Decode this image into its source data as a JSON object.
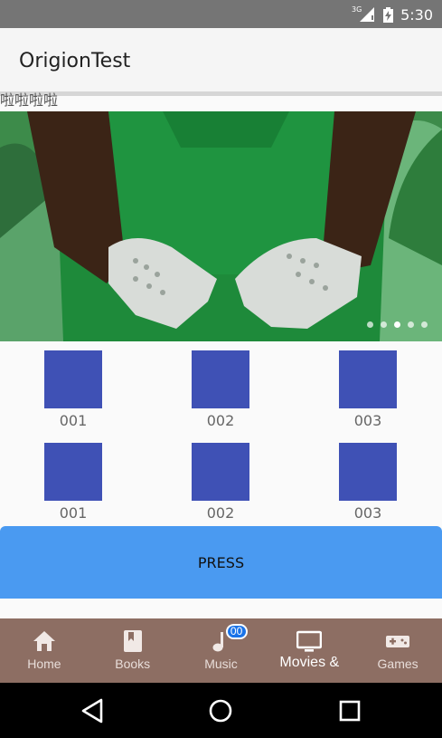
{
  "status_bar": {
    "time": "5:30",
    "network_label": "3G",
    "icons": [
      "signal-icon",
      "battery-icon"
    ]
  },
  "app_bar": {
    "title": "OrigionTest"
  },
  "marquee_text": "啦啦啦啦",
  "banner": {
    "image": "person in green shirt wearing white knitted gloves",
    "page_count": 5,
    "active_index": 2
  },
  "grid": {
    "rows": [
      [
        {
          "label": "001"
        },
        {
          "label": "002"
        },
        {
          "label": "003"
        }
      ],
      [
        {
          "label": "001"
        },
        {
          "label": "002"
        },
        {
          "label": "003"
        }
      ]
    ]
  },
  "press_button": {
    "label": "PRESS"
  },
  "bottom_nav": {
    "items": [
      {
        "label": "Home",
        "icon": "home-icon"
      },
      {
        "label": "Books",
        "icon": "book-icon"
      },
      {
        "label": "Music",
        "icon": "music-note-icon",
        "badge": "00"
      },
      {
        "label": "Movies &",
        "icon": "tv-icon",
        "active": true
      },
      {
        "label": "Games",
        "icon": "gamepad-icon"
      }
    ]
  },
  "system_nav": {
    "icons": [
      "back-icon",
      "home-circle-icon",
      "recents-icon"
    ]
  },
  "colors": {
    "status_bar": "#757575",
    "app_bar": "#f5f5f5",
    "grid_square": "#3f51b5",
    "press_button": "#4a9af1",
    "bottom_nav": "#8d6e63",
    "badge": "#1a73e8"
  }
}
